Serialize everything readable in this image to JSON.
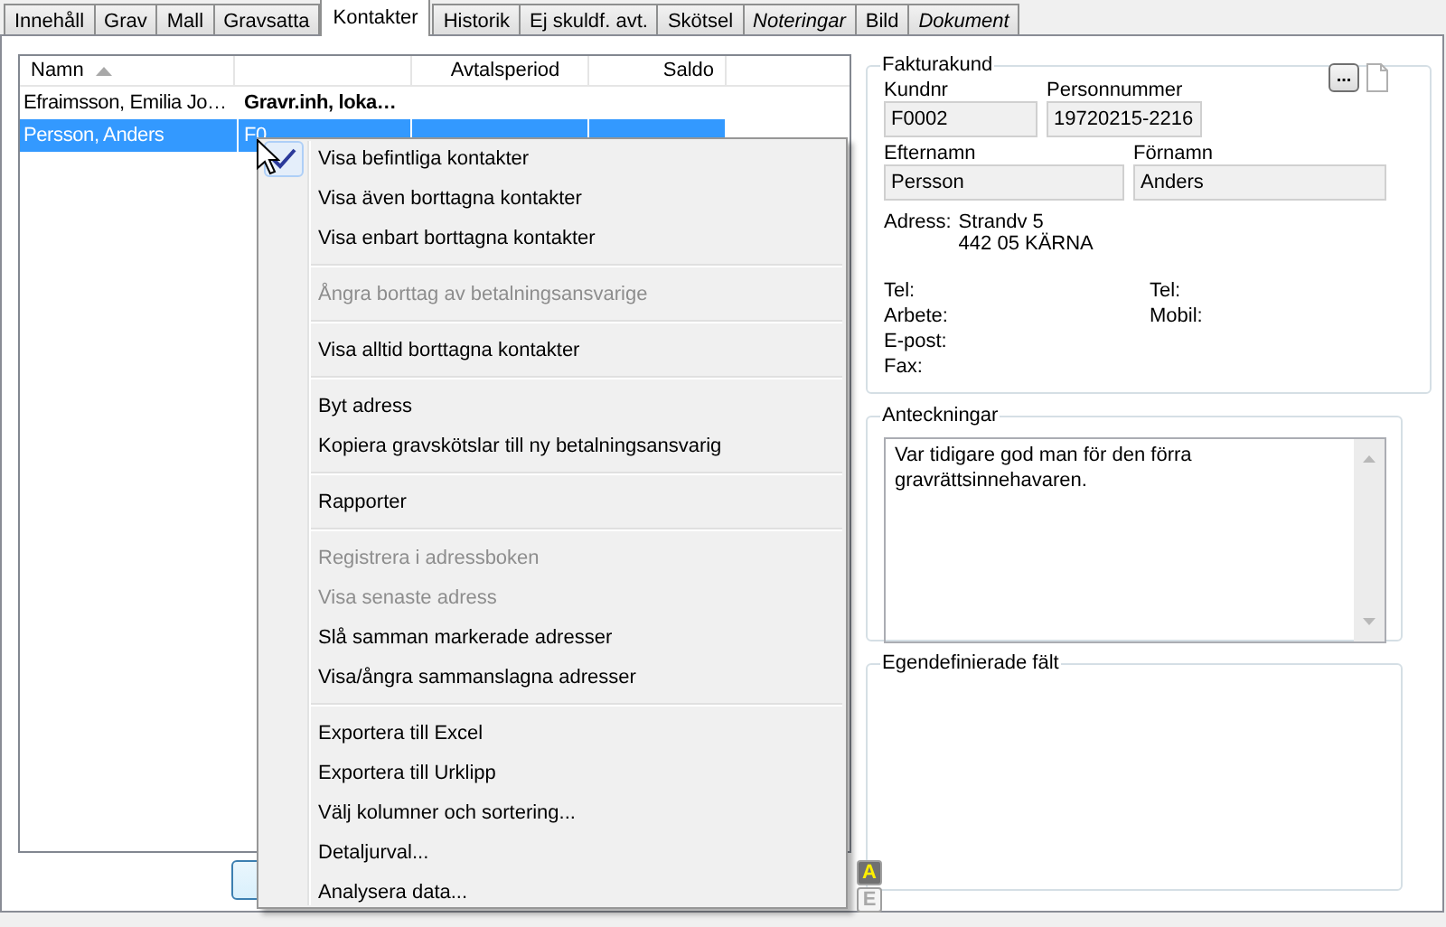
{
  "tabs": [
    {
      "label": "Innehåll",
      "selected": false,
      "italic": false
    },
    {
      "label": "Grav",
      "selected": false,
      "italic": false
    },
    {
      "label": "Mall",
      "selected": false,
      "italic": false
    },
    {
      "label": "Gravsatta",
      "selected": false,
      "italic": false
    },
    {
      "label": "Kontakter",
      "selected": true,
      "italic": false
    },
    {
      "label": "Historik",
      "selected": false,
      "italic": false
    },
    {
      "label": "Ej skuldf. avt.",
      "selected": false,
      "italic": false
    },
    {
      "label": "Skötsel",
      "selected": false,
      "italic": false
    },
    {
      "label": "Noteringar",
      "selected": false,
      "italic": true
    },
    {
      "label": "Bild",
      "selected": false,
      "italic": false
    },
    {
      "label": "Dokument",
      "selected": false,
      "italic": true
    }
  ],
  "contacts_table": {
    "columns": [
      {
        "label": "Namn",
        "sorted": true
      },
      {
        "sorted": false
      },
      {
        "label": "Avtalsperiod",
        "sorted": false
      },
      {
        "label": "Saldo",
        "sorted": false
      }
    ],
    "rows": [
      {
        "name": "Efraimsson, Emilia Jo…",
        "column_2": "Gravr.inh, loka…",
        "column_2_bold": true,
        "selected": false
      },
      {
        "name": "Persson, Anders",
        "column_2": "F0",
        "column_2_bold": false,
        "selected": true
      }
    ]
  },
  "context_menu": [
    {
      "kind": "item",
      "label": "Visa befintliga kontakter",
      "checked": true,
      "disabled": false
    },
    {
      "kind": "item",
      "label": "Visa även borttagna kontakter",
      "checked": false,
      "disabled": false
    },
    {
      "kind": "item",
      "label": "Visa enbart borttagna kontakter",
      "checked": false,
      "disabled": false
    },
    {
      "kind": "separator"
    },
    {
      "kind": "item",
      "label": "Ångra borttag av betalningsansvarige",
      "checked": false,
      "disabled": true
    },
    {
      "kind": "separator"
    },
    {
      "kind": "item",
      "label": "Visa alltid borttagna kontakter",
      "checked": false,
      "disabled": false
    },
    {
      "kind": "separator"
    },
    {
      "kind": "item",
      "label": "Byt adress",
      "checked": false,
      "disabled": false
    },
    {
      "kind": "item",
      "label": "Kopiera gravskötslar till ny betalningsansvarig",
      "checked": false,
      "disabled": false
    },
    {
      "kind": "separator"
    },
    {
      "kind": "item",
      "label": "Rapporter",
      "checked": false,
      "disabled": false
    },
    {
      "kind": "separator"
    },
    {
      "kind": "item",
      "label": "Registrera i adressboken",
      "checked": false,
      "disabled": true
    },
    {
      "kind": "item",
      "label": "Visa senaste adress",
      "checked": false,
      "disabled": true
    },
    {
      "kind": "item",
      "label": "Slå samman markerade adresser",
      "checked": false,
      "disabled": false
    },
    {
      "kind": "item",
      "label": "Visa/ångra sammanslagna adresser",
      "checked": false,
      "disabled": false
    },
    {
      "kind": "separator"
    },
    {
      "kind": "item",
      "label": "Exportera till Excel",
      "checked": false,
      "disabled": false
    },
    {
      "kind": "item",
      "label": "Exportera till Urklipp",
      "checked": false,
      "disabled": false
    },
    {
      "kind": "item",
      "label": "Välj kolumner och sortering...",
      "checked": false,
      "disabled": false
    },
    {
      "kind": "item",
      "label": "Detaljurval...",
      "checked": false,
      "disabled": false
    },
    {
      "kind": "item",
      "label": "Analysera data...",
      "checked": false,
      "disabled": false
    }
  ],
  "fakturakund": {
    "title": "Fakturakund",
    "more_button": "...",
    "kundnr": {
      "label": "Kundnr",
      "value": "F0002"
    },
    "personnummer": {
      "label": "Personnummer",
      "value": "19720215-2216"
    },
    "efternamn": {
      "label": "Efternamn",
      "value": "Persson"
    },
    "fornamn": {
      "label": "Förnamn",
      "value": "Anders"
    },
    "address_label": "Adress:",
    "address_lines": [
      "Strandv 5",
      "442 05  KÄRNA"
    ],
    "contact_labels_left": [
      "Tel:",
      "Arbete:",
      "E-post:",
      "Fax:"
    ],
    "contact_labels_right": [
      "Tel:",
      "Mobil:"
    ]
  },
  "anteckningar": {
    "title": "Anteckningar",
    "text": "Var tidigare god man för den förra gravrättsinnehavaren."
  },
  "egendefinierade": {
    "title": "Egendefinierade fält"
  },
  "side_buttons": [
    "A",
    "E"
  ]
}
